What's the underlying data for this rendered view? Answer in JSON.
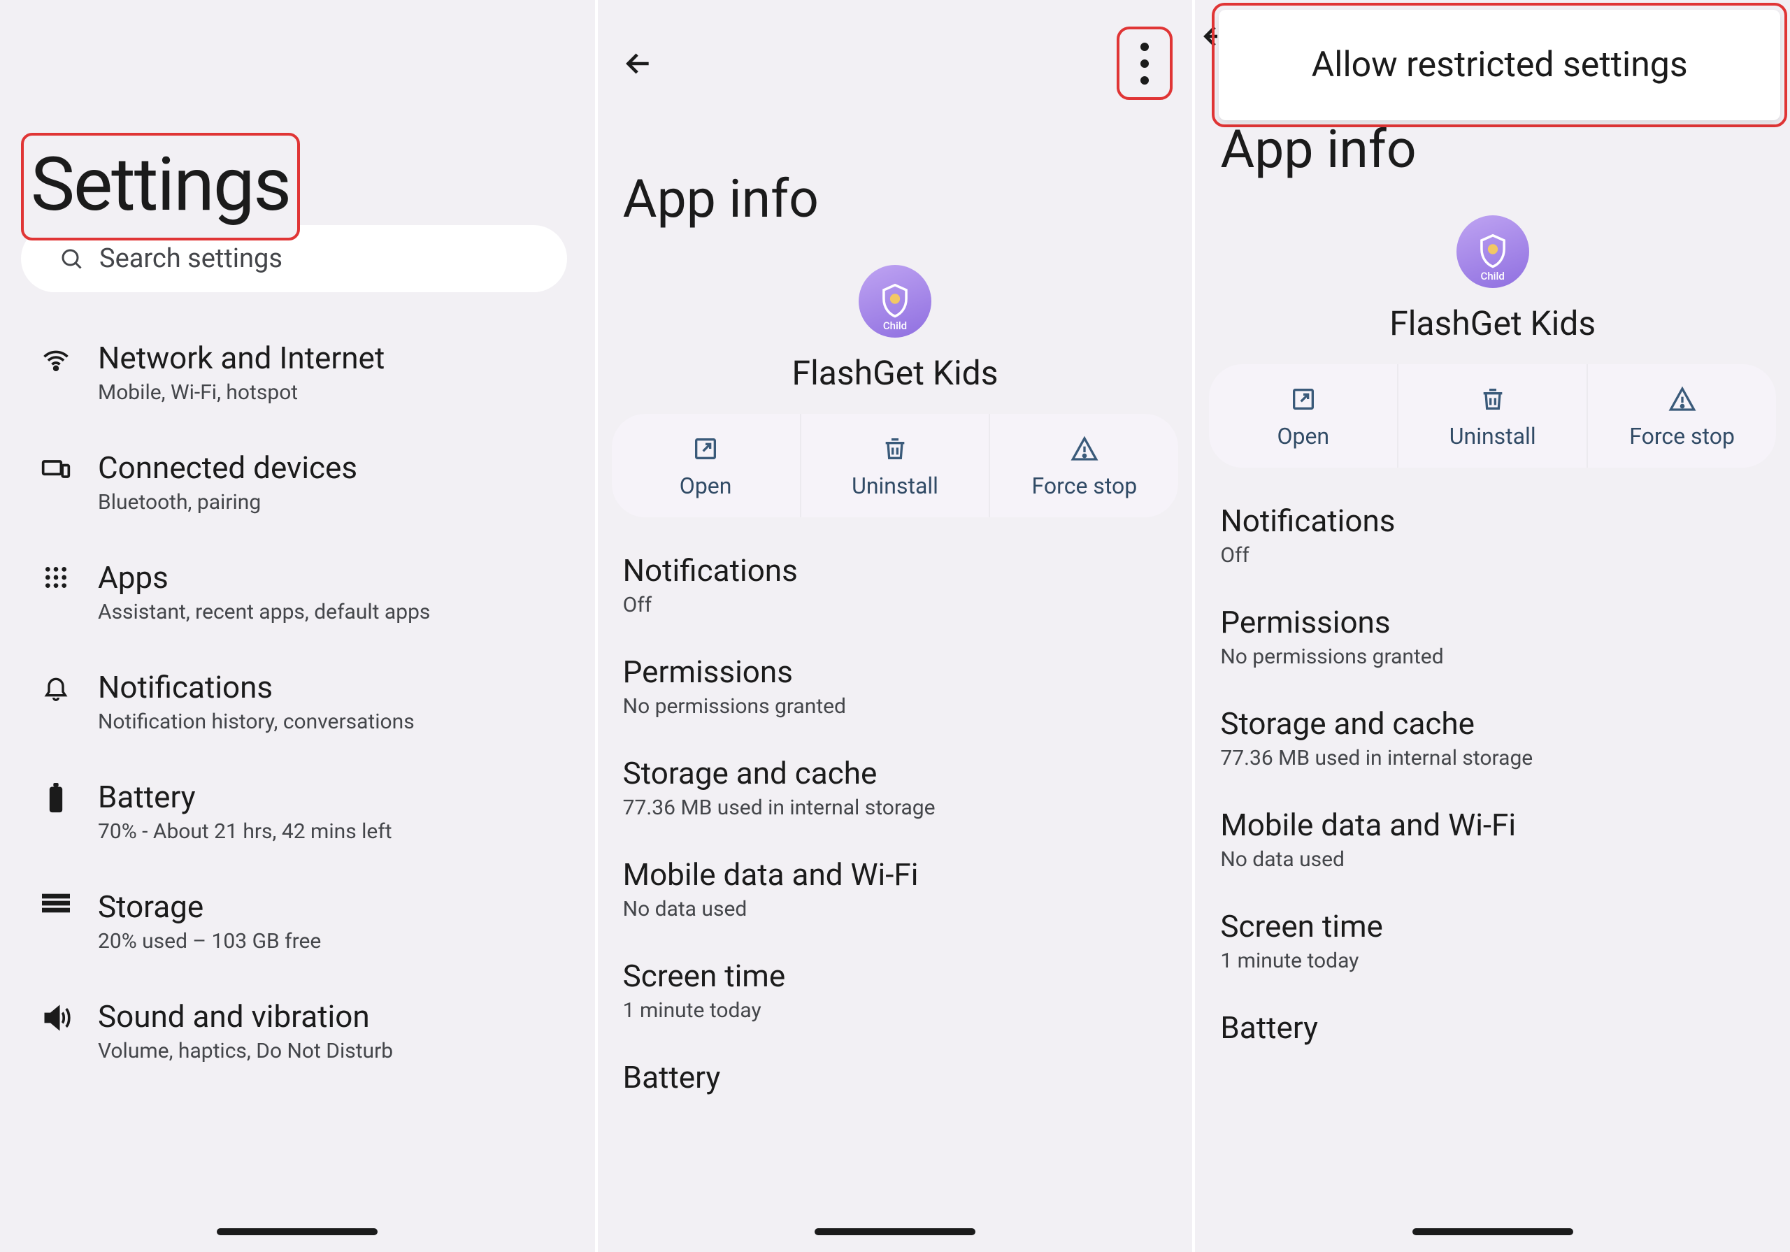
{
  "panel1": {
    "title": "Settings",
    "search_placeholder": "Search settings",
    "items": [
      {
        "title": "Network and Internet",
        "subtitle": "Mobile, Wi-Fi, hotspot"
      },
      {
        "title": "Connected devices",
        "subtitle": "Bluetooth, pairing"
      },
      {
        "title": "Apps",
        "subtitle": "Assistant, recent apps, default apps"
      },
      {
        "title": "Notifications",
        "subtitle": "Notification history, conversations"
      },
      {
        "title": "Battery",
        "subtitle": "70% - About 21 hrs, 42 mins left"
      },
      {
        "title": "Storage",
        "subtitle": "20% used – 103 GB free"
      },
      {
        "title": "Sound and vibration",
        "subtitle": "Volume, haptics, Do Not Disturb"
      }
    ]
  },
  "panel2": {
    "page_title": "App info",
    "app_name": "FlashGet Kids",
    "app_icon_label": "Child",
    "actions": {
      "open": "Open",
      "uninstall": "Uninstall",
      "force_stop": "Force stop"
    },
    "sections": [
      {
        "title": "Notifications",
        "subtitle": "Off"
      },
      {
        "title": "Permissions",
        "subtitle": "No permissions granted"
      },
      {
        "title": "Storage and cache",
        "subtitle": "77.36 MB used in internal storage"
      },
      {
        "title": "Mobile data and Wi-Fi",
        "subtitle": "No data used"
      },
      {
        "title": "Screen time",
        "subtitle": "1 minute today"
      },
      {
        "title": "Battery",
        "subtitle": ""
      }
    ]
  },
  "panel3": {
    "popup_label": "Allow restricted settings",
    "page_title": "App info",
    "app_name": "FlashGet Kids",
    "app_icon_label": "Child",
    "actions": {
      "open": "Open",
      "uninstall": "Uninstall",
      "force_stop": "Force stop"
    },
    "sections": [
      {
        "title": "Notifications",
        "subtitle": "Off"
      },
      {
        "title": "Permissions",
        "subtitle": "No permissions granted"
      },
      {
        "title": "Storage and cache",
        "subtitle": "77.36 MB used in internal storage"
      },
      {
        "title": "Mobile data and Wi-Fi",
        "subtitle": "No data used"
      },
      {
        "title": "Screen time",
        "subtitle": "1 minute today"
      },
      {
        "title": "Battery",
        "subtitle": ""
      }
    ]
  }
}
